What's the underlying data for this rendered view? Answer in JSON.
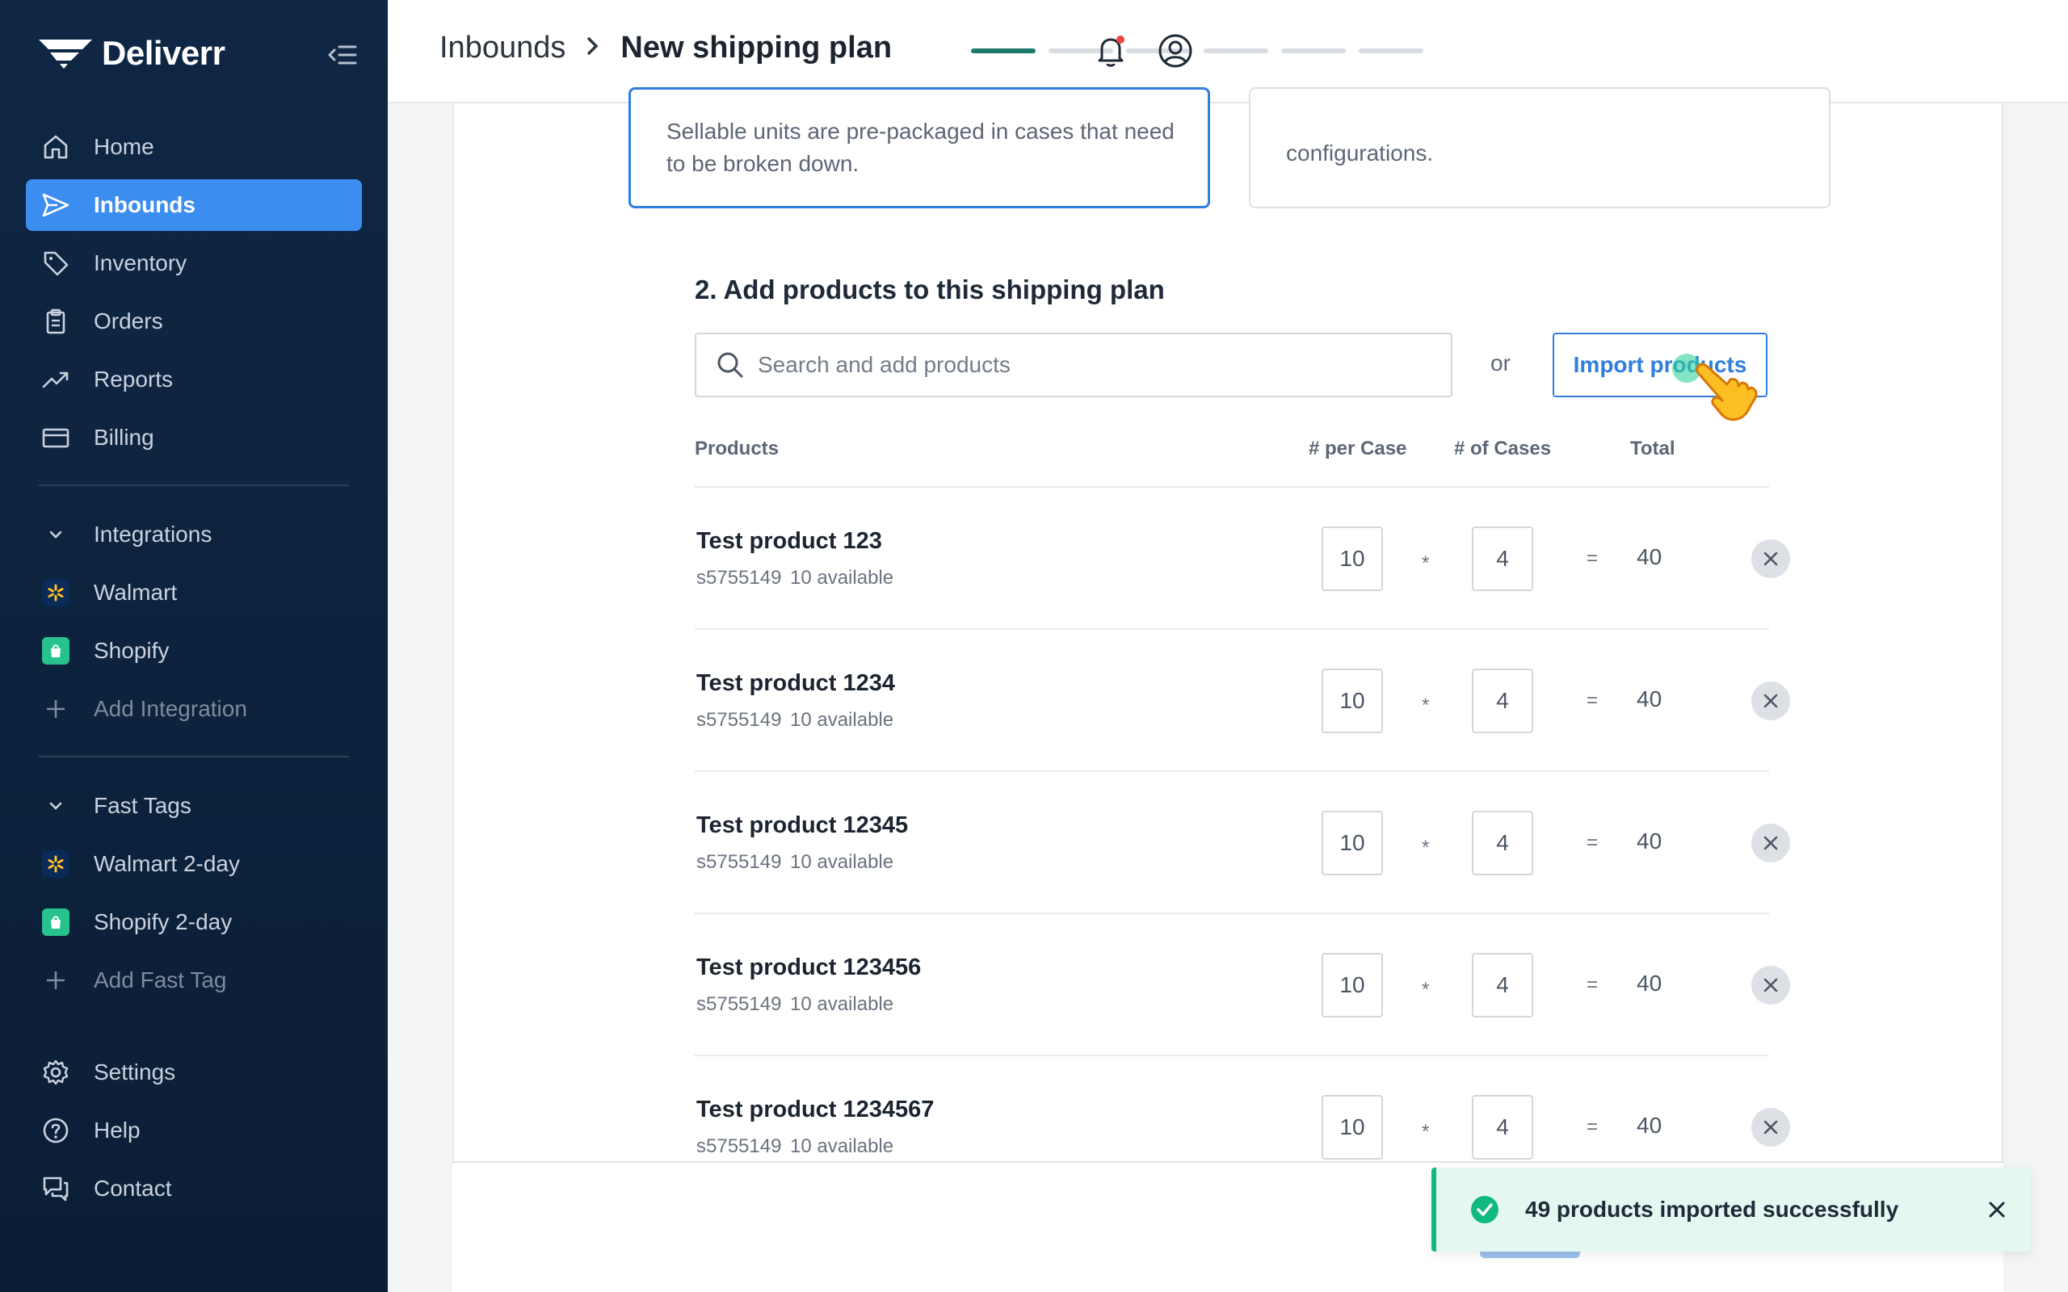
{
  "brand": {
    "name": "Deliverr"
  },
  "sidebar": {
    "main_items": [
      {
        "label": "Home",
        "icon": "home-icon"
      },
      {
        "label": "Inbounds",
        "icon": "send-icon",
        "active": true
      },
      {
        "label": "Inventory",
        "icon": "tag-icon"
      },
      {
        "label": "Orders",
        "icon": "clipboard-icon"
      },
      {
        "label": "Reports",
        "icon": "trending-up-icon"
      },
      {
        "label": "Billing",
        "icon": "credit-card-icon"
      }
    ],
    "integrations": {
      "heading": "Integrations",
      "items": [
        {
          "label": "Walmart",
          "icon": "walmart-icon"
        },
        {
          "label": "Shopify",
          "icon": "shopify-icon"
        }
      ],
      "add_label": "Add Integration"
    },
    "fast_tags": {
      "heading": "Fast Tags",
      "items": [
        {
          "label": "Walmart 2-day",
          "icon": "walmart-icon"
        },
        {
          "label": "Shopify 2-day",
          "icon": "shopify-icon"
        }
      ],
      "add_label": "Add Fast Tag"
    },
    "bottom_items": [
      {
        "label": "Settings",
        "icon": "gear-icon"
      },
      {
        "label": "Help",
        "icon": "help-icon"
      },
      {
        "label": "Contact",
        "icon": "chat-icon"
      }
    ]
  },
  "header": {
    "breadcrumb_parent": "Inbounds",
    "breadcrumb_separator": "›",
    "title": "New shipping plan",
    "progress_steps": 6,
    "progress_completed": 1
  },
  "options": {
    "selected_text": "Sellable units are pre-packaged in cases that need to be broken down.",
    "other_text": "configurations."
  },
  "section": {
    "title": "2. Add products to this shipping plan",
    "search_placeholder": "Search and add products",
    "or_text": "or",
    "import_label": "Import products"
  },
  "table": {
    "columns": [
      "Products",
      "# per Case",
      "# of Cases",
      "Total"
    ],
    "times_symbol": "*",
    "equals_symbol": "=",
    "rows": [
      {
        "name": "Test product 123",
        "sku": "s5755149",
        "available": "10 available",
        "per_case": "10",
        "cases": "4",
        "total": "40"
      },
      {
        "name": "Test product 1234",
        "sku": "s5755149",
        "available": "10 available",
        "per_case": "10",
        "cases": "4",
        "total": "40"
      },
      {
        "name": "Test product 12345",
        "sku": "s5755149",
        "available": "10 available",
        "per_case": "10",
        "cases": "4",
        "total": "40"
      },
      {
        "name": "Test product 123456",
        "sku": "s5755149",
        "available": "10 available",
        "per_case": "10",
        "cases": "4",
        "total": "40"
      },
      {
        "name": "Test product 1234567",
        "sku": "s5755149",
        "available": "10 available",
        "per_case": "10",
        "cases": "4",
        "total": "40"
      }
    ]
  },
  "toast": {
    "message": "49 products imported successfully"
  },
  "colors": {
    "accent": "#2f7ee0",
    "sidebar_bg": "#0f2744",
    "success": "#10b981",
    "progress_done": "#1c7a6b"
  }
}
